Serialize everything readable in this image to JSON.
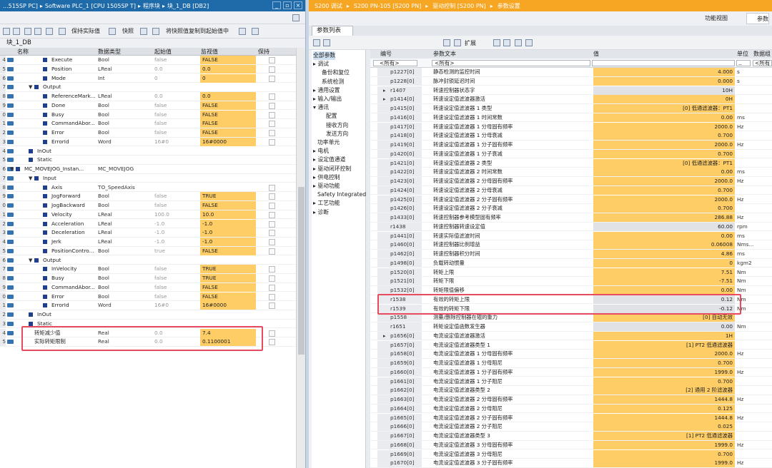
{
  "left": {
    "crumbs": [
      "...515SP PC]",
      "▸",
      "Software PLC_1 [CPU 1505SP T]",
      "▸",
      "程序块",
      "▸",
      "块_1_DB [DB2]"
    ],
    "toolbar": {
      "keep_actual": "保持实际值",
      "snapshot": "快照",
      "copy_snapshot": "将快照值复制到起始值中"
    },
    "block_title": "块_1_DB",
    "headers": {
      "name": "名称",
      "type": "数据类型",
      "start": "起始值",
      "monitor": "监视值",
      "retain": "保持"
    },
    "rows": [
      {
        "n": "4",
        "name": "Execute",
        "type": "Bool",
        "start": "false",
        "mon": "FALSE",
        "lvl": 2,
        "k": "pin",
        "blk": true
      },
      {
        "n": "5",
        "name": "Position",
        "type": "LReal",
        "start": "0.0",
        "mon": "0.0",
        "lvl": 2,
        "k": "pin",
        "blk": true
      },
      {
        "n": "6",
        "name": "Mode",
        "type": "Int",
        "start": "0",
        "mon": "0",
        "lvl": 2,
        "k": "pin",
        "blk": true
      },
      {
        "n": "7",
        "name": "Output",
        "type": "",
        "start": "",
        "mon": "",
        "lvl": 1,
        "k": "pin",
        "blk": true,
        "tri": "▼"
      },
      {
        "n": "8",
        "name": "ReferenceMark...",
        "type": "LReal",
        "start": "0.0",
        "mon": "0.0",
        "lvl": 2,
        "k": "pin",
        "blk": true
      },
      {
        "n": "9",
        "name": "Done",
        "type": "Bool",
        "start": "false",
        "mon": "FALSE",
        "lvl": 2,
        "k": "pin",
        "blk": true
      },
      {
        "n": "0",
        "name": "Busy",
        "type": "Bool",
        "start": "false",
        "mon": "FALSE",
        "lvl": 2,
        "k": "pin",
        "blk": true
      },
      {
        "n": "1",
        "name": "CommandAbor...",
        "type": "Bool",
        "start": "false",
        "mon": "FALSE",
        "lvl": 2,
        "k": "pin",
        "blk": true
      },
      {
        "n": "2",
        "name": "Error",
        "type": "Bool",
        "start": "false",
        "mon": "FALSE",
        "lvl": 2,
        "k": "pin",
        "blk": true
      },
      {
        "n": "3",
        "name": "ErrorId",
        "type": "Word",
        "start": "16#0",
        "mon": "16#0000",
        "lvl": 2,
        "k": "pin",
        "blk": true
      },
      {
        "n": "4",
        "name": "InOut",
        "type": "",
        "start": "",
        "mon": "",
        "lvl": 0,
        "k": "pin",
        "blk": true
      },
      {
        "n": "5",
        "name": "Static",
        "type": "",
        "start": "",
        "mon": "",
        "lvl": 0,
        "k": "pin",
        "blk": true
      },
      {
        "n": "6",
        "name": "MC_MOVEJOG_Instan...",
        "type": "MC_MOVEJOG",
        "start": "",
        "mon": "",
        "lvl": -1,
        "k": "pin",
        "blk": true,
        "tri": "▼"
      },
      {
        "n": "7",
        "name": "Input",
        "type": "",
        "start": "",
        "mon": "",
        "lvl": 1,
        "k": "pin",
        "blk": true,
        "tri": "▼"
      },
      {
        "n": "8",
        "name": "Axis",
        "type": "TO_SpeedAxis",
        "start": "",
        "mon": "",
        "lvl": 2,
        "k": "pin",
        "blk": true
      },
      {
        "n": "9",
        "name": "JogForward",
        "type": "Bool",
        "start": "false",
        "mon": "TRUE",
        "lvl": 2,
        "k": "pin",
        "blk": true
      },
      {
        "n": "0",
        "name": "JogBackward",
        "type": "Bool",
        "start": "false",
        "mon": "FALSE",
        "lvl": 2,
        "k": "pin",
        "blk": true
      },
      {
        "n": "1",
        "name": "Velocity",
        "type": "LReal",
        "start": "100.0",
        "mon": "10.0",
        "lvl": 2,
        "k": "pin",
        "blk": true
      },
      {
        "n": "2",
        "name": "Acceleration",
        "type": "LReal",
        "start": "-1.0",
        "mon": "-1.0",
        "lvl": 2,
        "k": "pin",
        "blk": true
      },
      {
        "n": "3",
        "name": "Deceleration",
        "type": "LReal",
        "start": "-1.0",
        "mon": "-1.0",
        "lvl": 2,
        "k": "pin",
        "blk": true
      },
      {
        "n": "4",
        "name": "Jerk",
        "type": "LReal",
        "start": "-1.0",
        "mon": "-1.0",
        "lvl": 2,
        "k": "pin",
        "blk": true
      },
      {
        "n": "5",
        "name": "PositionContro...",
        "type": "Bool",
        "start": "true",
        "mon": "FALSE",
        "lvl": 2,
        "k": "pin",
        "blk": true
      },
      {
        "n": "6",
        "name": "Output",
        "type": "",
        "start": "",
        "mon": "",
        "lvl": 1,
        "k": "pin",
        "blk": true,
        "tri": "▼"
      },
      {
        "n": "7",
        "name": "InVelocity",
        "type": "Bool",
        "start": "false",
        "mon": "TRUE",
        "lvl": 2,
        "k": "pin",
        "blk": true
      },
      {
        "n": "8",
        "name": "Busy",
        "type": "Bool",
        "start": "false",
        "mon": "TRUE",
        "lvl": 2,
        "k": "pin",
        "blk": true
      },
      {
        "n": "9",
        "name": "CommandAbor...",
        "type": "Bool",
        "start": "false",
        "mon": "FALSE",
        "lvl": 2,
        "k": "pin",
        "blk": true
      },
      {
        "n": "0",
        "name": "Error",
        "type": "Bool",
        "start": "false",
        "mon": "FALSE",
        "lvl": 2,
        "k": "pin",
        "blk": true
      },
      {
        "n": "1",
        "name": "ErrorId",
        "type": "Word",
        "start": "16#0",
        "mon": "16#0000",
        "lvl": 2,
        "k": "pin",
        "blk": true
      },
      {
        "n": "2",
        "name": "InOut",
        "type": "",
        "start": "",
        "mon": "",
        "lvl": 0,
        "k": "pin",
        "blk": true
      },
      {
        "n": "3",
        "name": "Static",
        "type": "",
        "start": "",
        "mon": "",
        "lvl": 0,
        "k": "pin",
        "blk": true
      },
      {
        "n": "4",
        "name": "转矩减少值",
        "type": "Real",
        "start": "0.0",
        "mon": "7.4",
        "lvl": -2,
        "k": "pin",
        "blk": false
      },
      {
        "n": "5",
        "name": "实际转矩限制",
        "type": "Real",
        "start": "0.0",
        "mon": "0.1100001",
        "lvl": -2,
        "k": "pin",
        "blk": false
      }
    ]
  },
  "right": {
    "crumbs": [
      "S200 调试",
      "▸",
      "S200 PN-105 [S200 PN]",
      "▸",
      "驱动控制 [S200 PN]",
      "▸",
      "参数设置"
    ],
    "view_tabs": {
      "function": "功能视图",
      "params": "参数"
    },
    "param_tab": "参数列表",
    "toolbar": {
      "expand": "扩展"
    },
    "nav": [
      "全部参数",
      "调试",
      "备份和复位",
      "系统检测",
      "通用设置",
      "输入/输出",
      "通讯",
      "配置",
      "接收方向",
      "发送方向",
      "功率单元",
      "电机",
      "设定值通道",
      "驱动闭环控制",
      "供电控制",
      "驱动功能",
      "Safety Integrated",
      "工艺功能",
      "诊断"
    ],
    "headers": {
      "no": "编号",
      "text": "参数文本",
      "value": "值",
      "unit": "单位",
      "group": "数据组"
    },
    "filter": {
      "no": "<所有>",
      "text": "<所有>",
      "unit": "..",
      "group": "<所有"
    },
    "rows": [
      [
        "p1227[0]",
        "静态检测的监控时间",
        "4.000",
        "s",
        ""
      ],
      [
        "p1228[0]",
        "脉冲封锁延迟时间",
        "0.000",
        "s",
        ""
      ],
      [
        "r1407",
        "转速控制器状态字",
        "10H",
        "",
        "▸"
      ],
      [
        "p1414[0]",
        "转速设定值滤波器激活",
        "0H",
        "",
        "▸"
      ],
      [
        "p1415[0]",
        "转速设定值滤波器 1 类型",
        "[0] 低通滤波器：PT1",
        "",
        ""
      ],
      [
        "p1416[0]",
        "转速设定值滤波器 1 时间常数",
        "0.00",
        "ms",
        ""
      ],
      [
        "p1417[0]",
        "转速设定值滤波器 1 分母固有频率",
        "2000.0",
        "Hz",
        ""
      ],
      [
        "p1418[0]",
        "转速设定值滤波器 1 分母衰减",
        "0.700",
        "",
        ""
      ],
      [
        "p1419[0]",
        "转速设定值滤波器 1 分子固有频率",
        "2000.0",
        "Hz",
        ""
      ],
      [
        "p1420[0]",
        "转速设定值滤波器 1 分子衰减",
        "0.700",
        "",
        ""
      ],
      [
        "p1421[0]",
        "转速设定值滤波器 2 类型",
        "[0] 低通滤波器：PT1",
        "",
        ""
      ],
      [
        "p1422[0]",
        "转速设定值滤波器 2 时间常数",
        "0.00",
        "ms",
        ""
      ],
      [
        "p1423[0]",
        "转速设定值滤波器 2 分母固有频率",
        "2000.0",
        "Hz",
        ""
      ],
      [
        "p1424[0]",
        "转速设定值滤波器 2 分母衰减",
        "0.700",
        "",
        ""
      ],
      [
        "p1425[0]",
        "转速设定值滤波器 2 分子固有频率",
        "2000.0",
        "Hz",
        ""
      ],
      [
        "p1426[0]",
        "转速设定值滤波器 2 分子衰减",
        "0.700",
        "",
        ""
      ],
      [
        "p1433[0]",
        "转速控制器参考模型固有频率",
        "286.88",
        "Hz",
        ""
      ],
      [
        "r1438",
        "转速控制器转速设定值",
        "60.00",
        "rpm",
        ""
      ],
      [
        "p1441[0]",
        "转速实际值滤波时间",
        "0.00",
        "ms",
        ""
      ],
      [
        "p1460[0]",
        "转速控制器比例增益",
        "0.06008",
        "Nms...",
        ""
      ],
      [
        "p1462[0]",
        "转速控制器积分时间",
        "4.86",
        "ms",
        ""
      ],
      [
        "p1498[0]",
        "负载转动惯量",
        "0",
        "kgm2",
        ""
      ],
      [
        "p1520[0]",
        "转矩上限",
        "7.51",
        "Nm",
        ""
      ],
      [
        "p1521[0]",
        "转矩下限",
        "-7.51",
        "Nm",
        ""
      ],
      [
        "p1532[0]",
        "转矩限值偏移",
        "0.00",
        "Nm",
        ""
      ],
      [
        "r1538",
        "有效的转矩上限",
        "0.12",
        "Nm",
        ""
      ],
      [
        "r1539",
        "有效的转矩下限",
        "-0.12",
        "Nm",
        ""
      ],
      [
        "p1558",
        "测量/删除控制器在辊的重力",
        "[0] 自动无效",
        "",
        ""
      ],
      [
        "r1651",
        "转矩设定值函数发生器",
        "0.00",
        "Nm",
        ""
      ],
      [
        "p1656[0]",
        "电流设定值滤波器激活",
        "1H",
        "",
        "▸"
      ],
      [
        "p1657[0]",
        "电流设定值滤波器类型 1",
        "[1] PT2 低通滤波器",
        "",
        ""
      ],
      [
        "p1658[0]",
        "电流设定值滤波器 1 分母固有频率",
        "2000.0",
        "Hz",
        ""
      ],
      [
        "p1659[0]",
        "电流设定值滤波器 1 分母阻尼",
        "0.700",
        "",
        ""
      ],
      [
        "p1660[0]",
        "电流设定值滤波器 1 分子固有频率",
        "1999.0",
        "Hz",
        ""
      ],
      [
        "p1661[0]",
        "电流设定值滤波器 1 分子阻尼",
        "0.700",
        "",
        ""
      ],
      [
        "p1662[0]",
        "电流设定值滤波器类型 2",
        "[2] 通用 2 阶滤波器",
        "",
        ""
      ],
      [
        "p1663[0]",
        "电流设定值滤波器 2 分母固有频率",
        "1444.8",
        "Hz",
        ""
      ],
      [
        "p1664[0]",
        "电流设定值滤波器 2 分母阻尼",
        "0.125",
        "",
        ""
      ],
      [
        "p1665[0]",
        "电流设定值滤波器 2 分子固有频率",
        "1444.8",
        "Hz",
        ""
      ],
      [
        "p1666[0]",
        "电流设定值滤波器 2 分子阻尼",
        "0.025",
        "",
        ""
      ],
      [
        "p1667[0]",
        "电流设定值滤波器类型 3",
        "[1] PT2 低通滤波器",
        "",
        ""
      ],
      [
        "p1668[0]",
        "电流设定值滤波器 3 分母固有频率",
        "1999.0",
        "Hz",
        ""
      ],
      [
        "p1669[0]",
        "电流设定值滤波器 3 分母阻尼",
        "0.700",
        "",
        ""
      ],
      [
        "p1670[0]",
        "电流设定值滤波器 3 分子固有频率",
        "1999.0",
        "Hz",
        ""
      ]
    ]
  }
}
